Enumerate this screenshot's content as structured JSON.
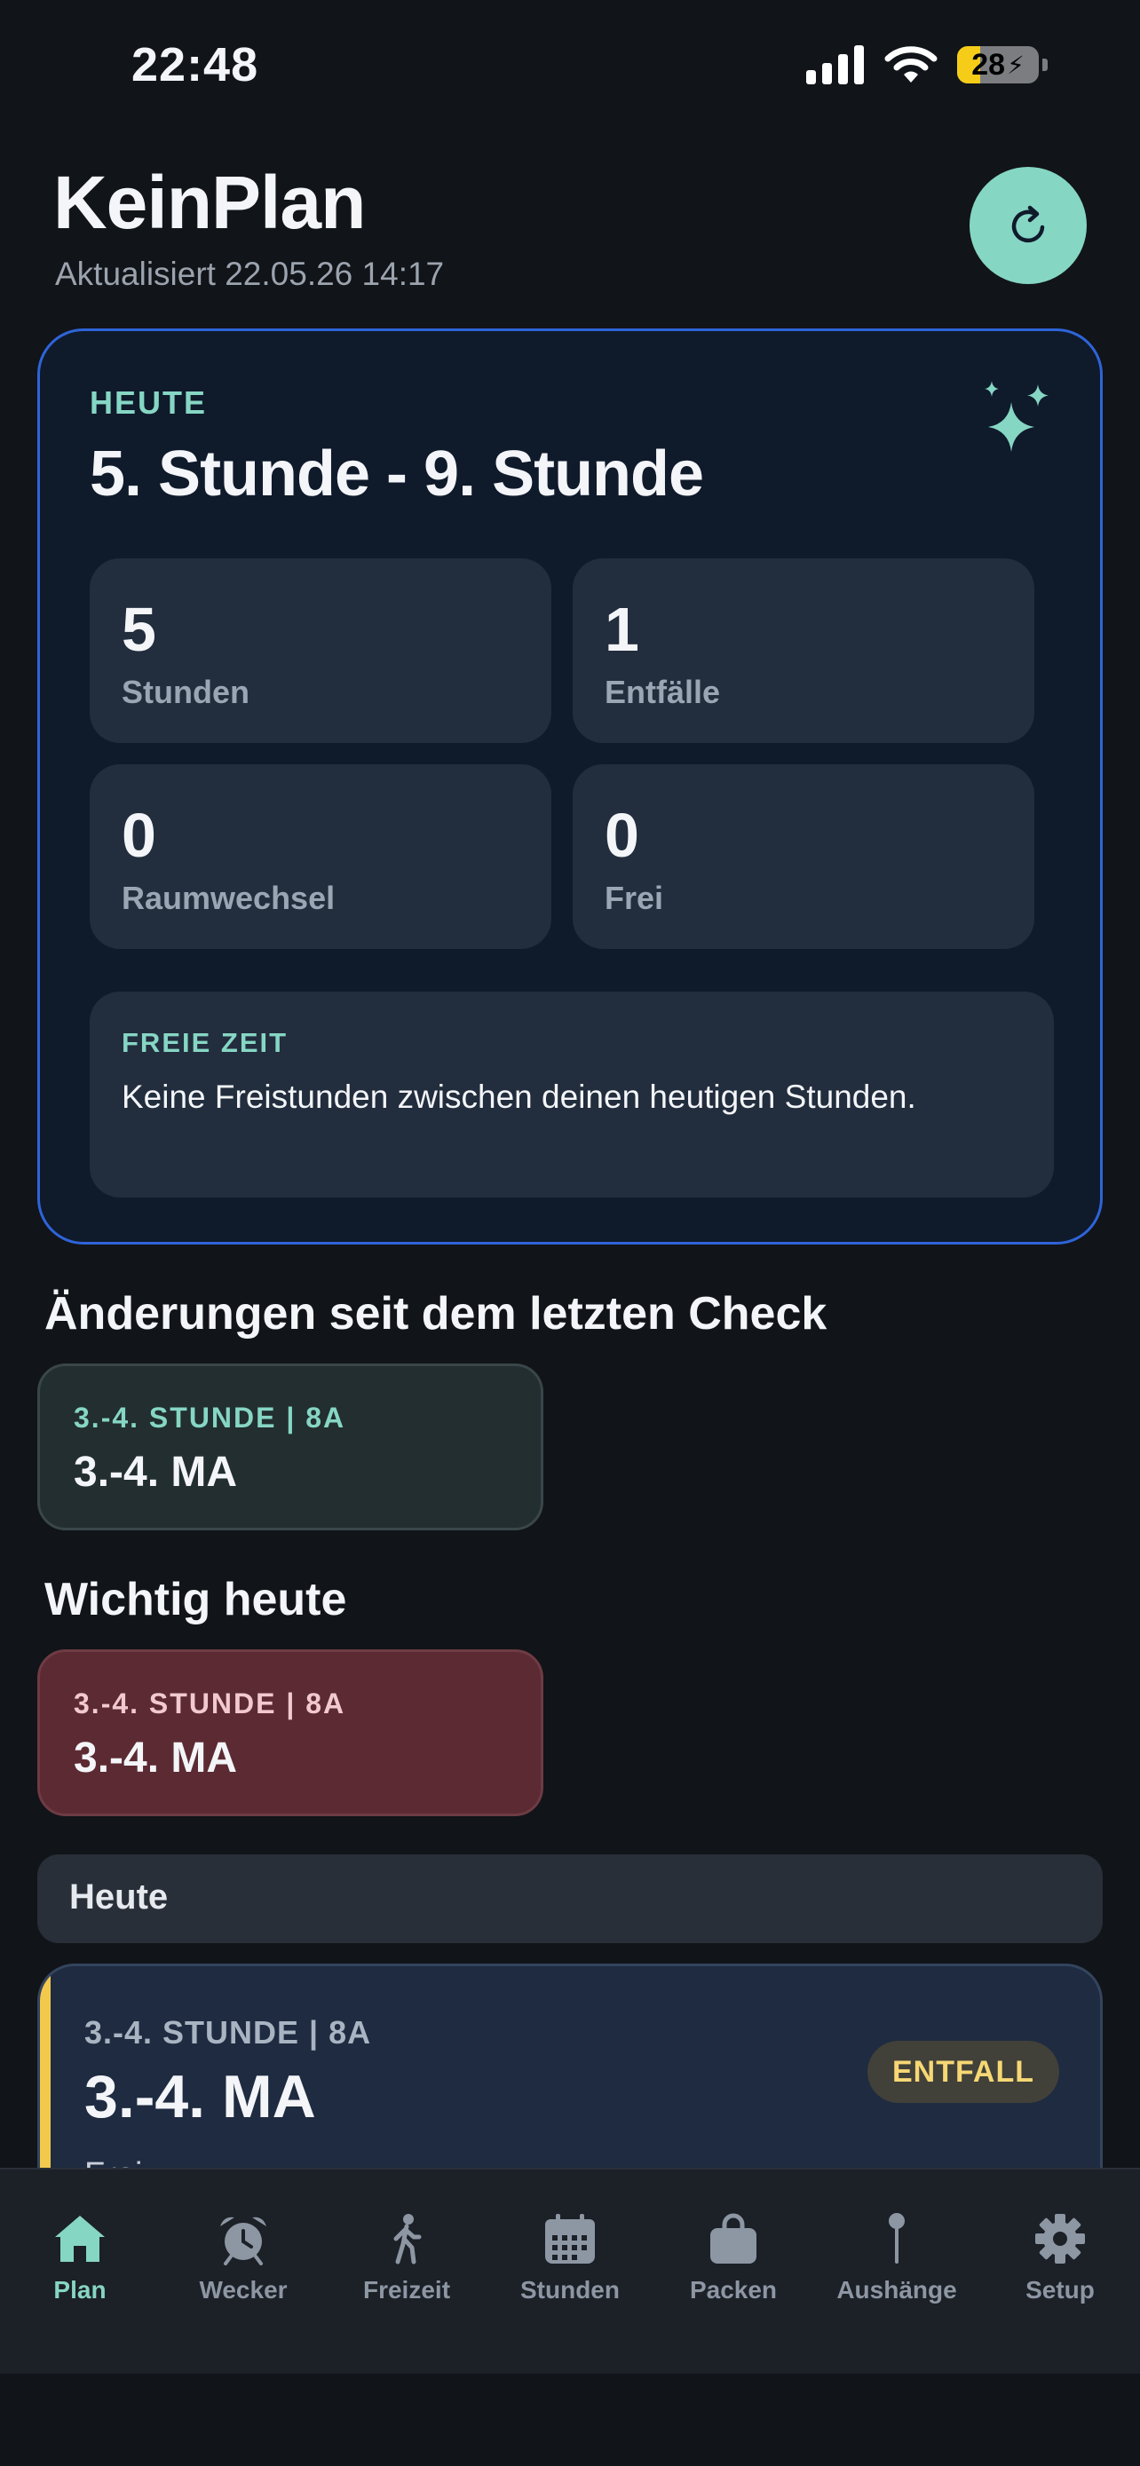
{
  "status_bar": {
    "time": "22:48",
    "battery": "28",
    "battery_level": 0.28
  },
  "header": {
    "title": "KeinPlan",
    "subtitle": "Aktualisiert 22.05.26 14:17"
  },
  "today": {
    "label": "HEUTE",
    "heading": "5. Stunde - 9. Stunde",
    "stats": [
      {
        "value": "5",
        "label": "Stunden"
      },
      {
        "value": "1",
        "label": "Entfälle"
      },
      {
        "value": "0",
        "label": "Raumwechsel"
      },
      {
        "value": "0",
        "label": "Frei"
      }
    ],
    "free_time": {
      "label": "FREIE ZEIT",
      "text": "Keine Freistunden zwischen deinen heutigen Stunden."
    }
  },
  "changes": {
    "title": "Änderungen seit dem letzten Check",
    "cards": [
      {
        "meta": "3.-4. STUNDE | 8A",
        "title": "3.-4. MA"
      }
    ]
  },
  "important": {
    "title": "Wichtig heute",
    "cards": [
      {
        "meta": "3.-4. STUNDE | 8A",
        "title": "3.-4. MA"
      }
    ]
  },
  "today_list": {
    "header": "Heute",
    "lessons": [
      {
        "meta": "3.-4. STUNDE | 8A",
        "title": "3.-4. MA",
        "badge": "ENTFALL",
        "subtitle": "Frei"
      }
    ]
  },
  "colors": {
    "accent": "#86D6C4",
    "card_border": "#2E64D8",
    "warning": "#F2C94C",
    "important_bg": "#5C2A33"
  },
  "tabs": [
    {
      "label": "Plan",
      "icon": "home-icon",
      "active": true
    },
    {
      "label": "Wecker",
      "icon": "alarm-clock-icon"
    },
    {
      "label": "Freizeit",
      "icon": "walking-icon"
    },
    {
      "label": "Stunden",
      "icon": "calendar-icon"
    },
    {
      "label": "Packen",
      "icon": "bag-icon"
    },
    {
      "label": "Aushänge",
      "icon": "pin-icon"
    },
    {
      "label": "Setup",
      "icon": "gear-icon"
    }
  ]
}
